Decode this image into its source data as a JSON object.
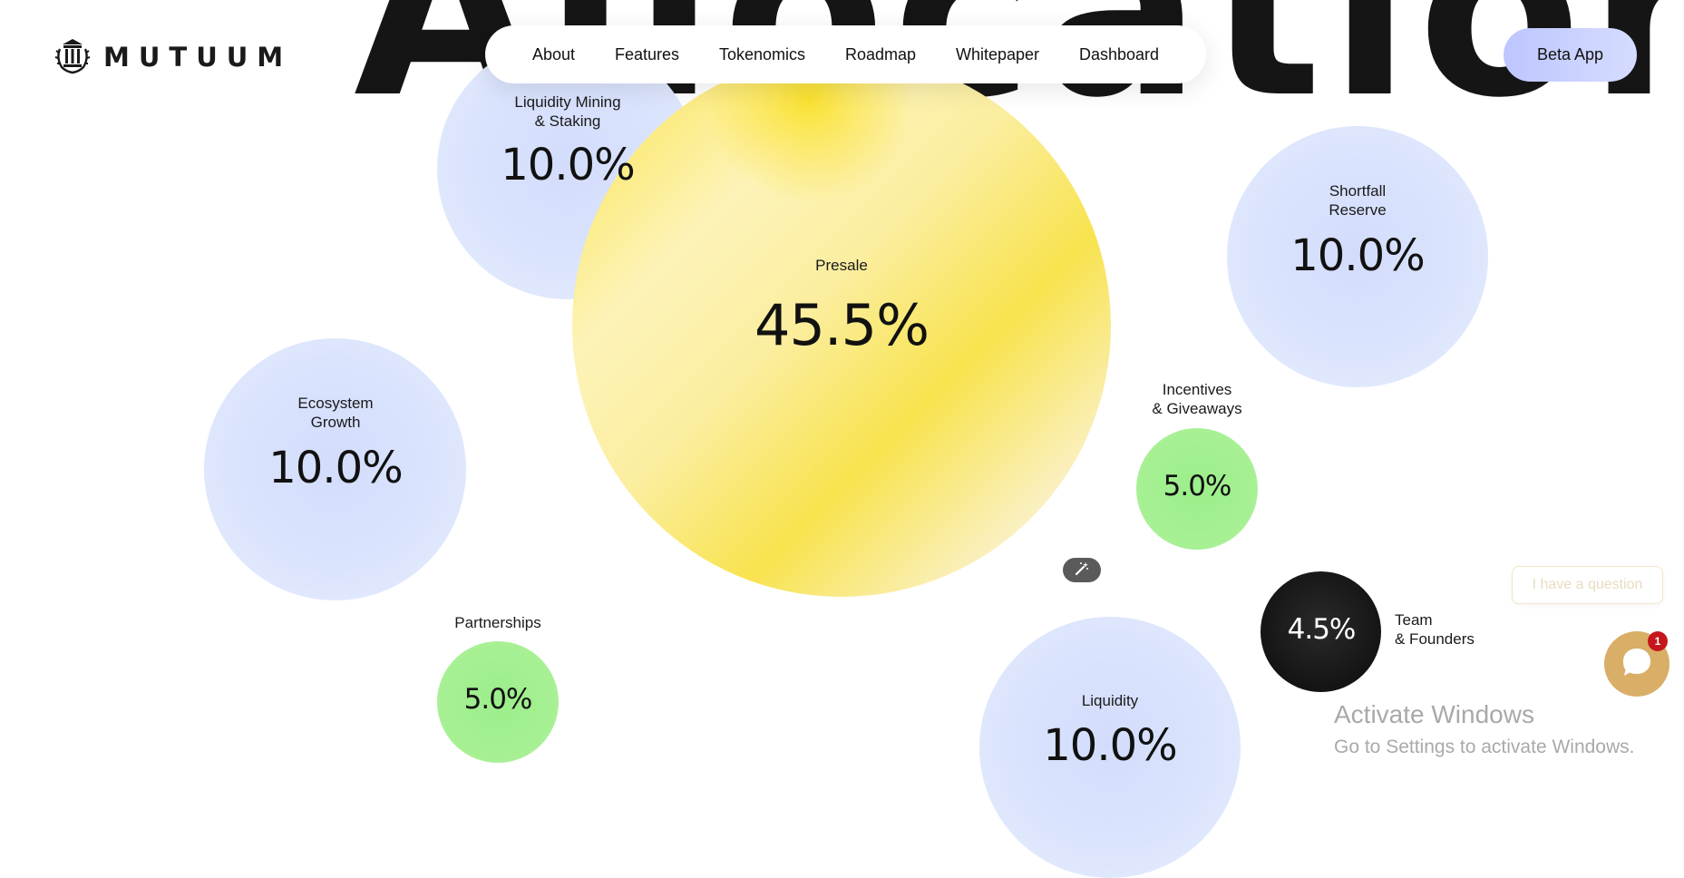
{
  "background_heading": "Allocation",
  "brand": {
    "name": "MUTUUM",
    "logo_icon": "temple-laurel-icon"
  },
  "nav": {
    "items": [
      "About",
      "Features",
      "Tokenomics",
      "Roadmap",
      "Whitepaper",
      "Dashboard"
    ]
  },
  "cta": {
    "label": "Beta App"
  },
  "allocation": [
    {
      "name": "Liquidity Mining\n& Staking",
      "percent": "10.0%",
      "color": "#d9e2fc"
    },
    {
      "name": "Presale",
      "percent": "45.5%",
      "color": "#fbe34a"
    },
    {
      "name": "Shortfall\nReserve",
      "percent": "10.0%",
      "color": "#d9e2fc"
    },
    {
      "name": "Ecosystem\nGrowth",
      "percent": "10.0%",
      "color": "#d9e2fc"
    },
    {
      "name": "Incentives\n& Giveaways",
      "percent": "5.0%",
      "color": "#a3ef90"
    },
    {
      "name": "Partnerships",
      "percent": "5.0%",
      "color": "#a3ef90"
    },
    {
      "name": "Liquidity",
      "percent": "10.0%",
      "color": "#d9e2fc"
    },
    {
      "name": "Team\n& Founders",
      "percent": "4.5%",
      "color": "#151515"
    }
  ],
  "tool_chip": {
    "icon": "magic-wand-icon"
  },
  "chat": {
    "prompt": "I have a question",
    "badge_count": "1",
    "icon": "chat-bubble-icon",
    "accent": "#d9ae67"
  },
  "os_watermark": {
    "title": "Activate Windows",
    "subtitle": "Go to Settings to activate Windows."
  }
}
